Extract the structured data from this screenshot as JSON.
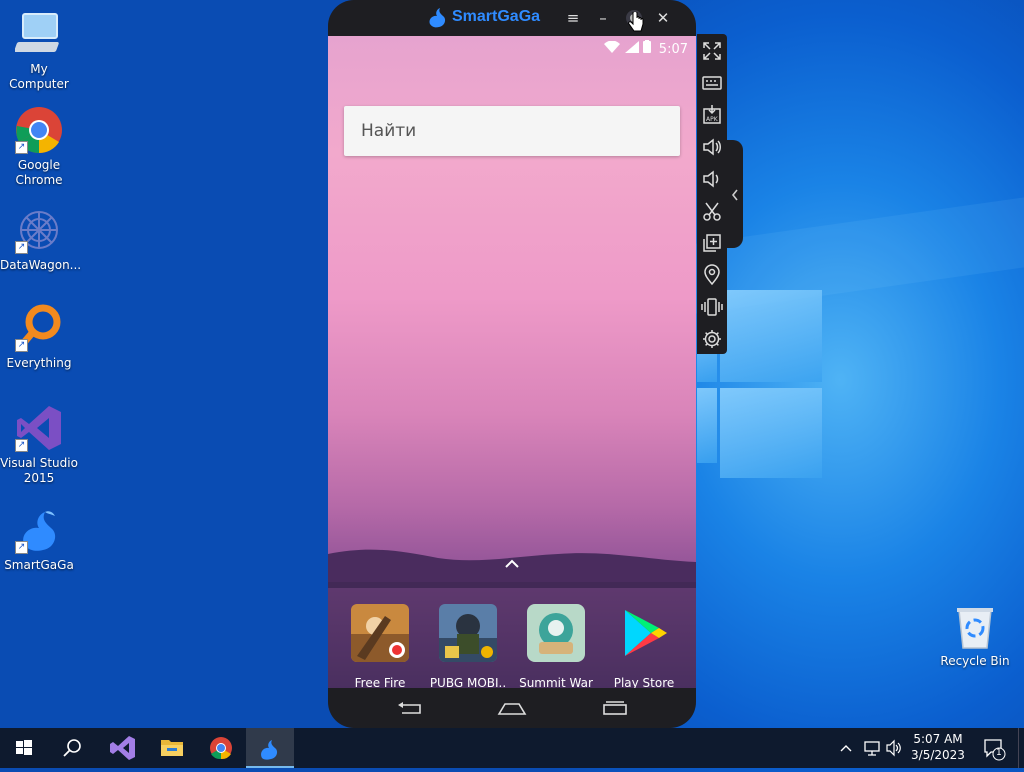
{
  "desktop": {
    "icons": [
      {
        "label": "My Computer",
        "icon": "computer-icon"
      },
      {
        "label": "Google Chrome",
        "icon": "chrome-icon"
      },
      {
        "label": "DataWagon...",
        "icon": "datawagon-icon"
      },
      {
        "label": "Everything",
        "icon": "everything-icon"
      },
      {
        "label": "Visual Studio 2015",
        "icon": "visual-studio-icon"
      },
      {
        "label": "SmartGaGa",
        "icon": "smartgaga-icon"
      },
      {
        "label": "Recycle Bin",
        "icon": "recycle-bin-icon"
      }
    ]
  },
  "emulator": {
    "title": "SmartGaGa",
    "title_buttons": [
      "menu-icon",
      "minimize-icon",
      "record-icon",
      "close-icon"
    ],
    "status_time": "5:07",
    "search_placeholder": "Найти",
    "apps": [
      {
        "label": "Free Fire",
        "icon": "free-fire-icon"
      },
      {
        "label": "PUBG MOBI..",
        "icon": "pubg-mobile-icon"
      },
      {
        "label": "Summit War",
        "icon": "summit-war-icon"
      },
      {
        "label": "Play Store",
        "icon": "play-store-icon"
      }
    ],
    "sidebar_tools": [
      "fullscreen-icon",
      "keyboard-icon",
      "apk-icon",
      "volume-up-icon",
      "volume-down-icon",
      "screenshot-scissors-icon",
      "multi-instance-icon",
      "location-icon",
      "shake-icon",
      "settings-icon"
    ]
  },
  "taskbar": {
    "items": [
      "start-icon",
      "search-icon",
      "visual-studio-icon",
      "file-explorer-icon",
      "chrome-icon",
      "smartgaga-icon"
    ],
    "clock_time": "5:07 AM",
    "clock_date": "3/5/2023",
    "notification_count": "1"
  },
  "colors": {
    "accent": "#2f8bff",
    "taskbar": "#0e1a2e",
    "desktop": "#0b5fcf"
  }
}
